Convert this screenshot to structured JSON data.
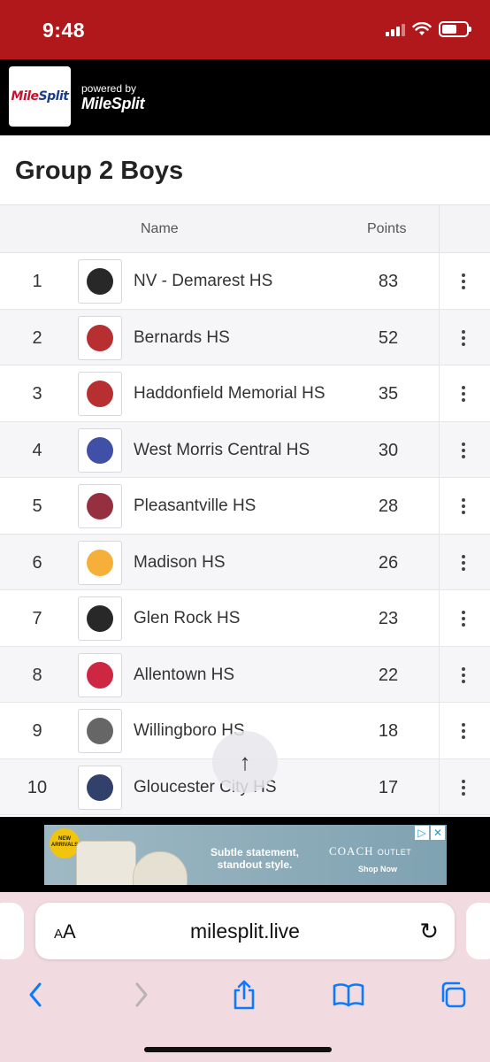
{
  "status_bar": {
    "time": "9:48"
  },
  "header": {
    "logo_text_a": "Mile",
    "logo_text_b": "Split",
    "powered_by": "powered by",
    "brand": "MileSplit"
  },
  "page_title": "Group 2 Boys",
  "table": {
    "columns": {
      "name": "Name",
      "points": "Points"
    },
    "rows": [
      {
        "rank": "1",
        "team": "NV - Demarest HS",
        "points": "83",
        "logo_icon": "viking-logo-icon",
        "logo_color": "#111111"
      },
      {
        "rank": "2",
        "team": "Bernards HS",
        "points": "52",
        "logo_icon": "letter-b-logo-icon",
        "logo_color": "#b0181c"
      },
      {
        "rank": "3",
        "team": "Haddonfield Memorial HS",
        "points": "35",
        "logo_icon": "bulldog-logo-icon",
        "logo_color": "#b0181c"
      },
      {
        "rank": "4",
        "team": "West Morris Central HS",
        "points": "30",
        "logo_icon": "wolf-logo-icon",
        "logo_color": "#2a3d9c"
      },
      {
        "rank": "5",
        "team": "Pleasantville HS",
        "points": "28",
        "logo_icon": "greyhound-logo-icon",
        "logo_color": "#8b1a2b"
      },
      {
        "rank": "6",
        "team": "Madison HS",
        "points": "26",
        "logo_icon": "letter-m-logo-icon",
        "logo_color": "#f5a623"
      },
      {
        "rank": "7",
        "team": "Glen Rock HS",
        "points": "23",
        "logo_icon": "panther-logo-icon",
        "logo_color": "#111111"
      },
      {
        "rank": "8",
        "team": "Allentown HS",
        "points": "22",
        "logo_icon": "redbirds-logo-icon",
        "logo_color": "#c8102e"
      },
      {
        "rank": "9",
        "team": "Willingboro HS",
        "points": "18",
        "logo_icon": "chimeras-logo-icon",
        "logo_color": "#555555"
      },
      {
        "rank": "10",
        "team": "Gloucester City HS",
        "points": "17",
        "logo_icon": "wings-g-logo-icon",
        "logo_color": "#1c2c5c"
      }
    ]
  },
  "scroll_top_glyph": "↑",
  "ad": {
    "badge": "NEW ARRIVALS",
    "slogan": "Subtle statement, standout style.",
    "brand": "COACH",
    "brand_suffix": "OUTLET",
    "cta": "Shop Now"
  },
  "browser": {
    "text_size_label": "AA",
    "url": "milesplit.live"
  }
}
